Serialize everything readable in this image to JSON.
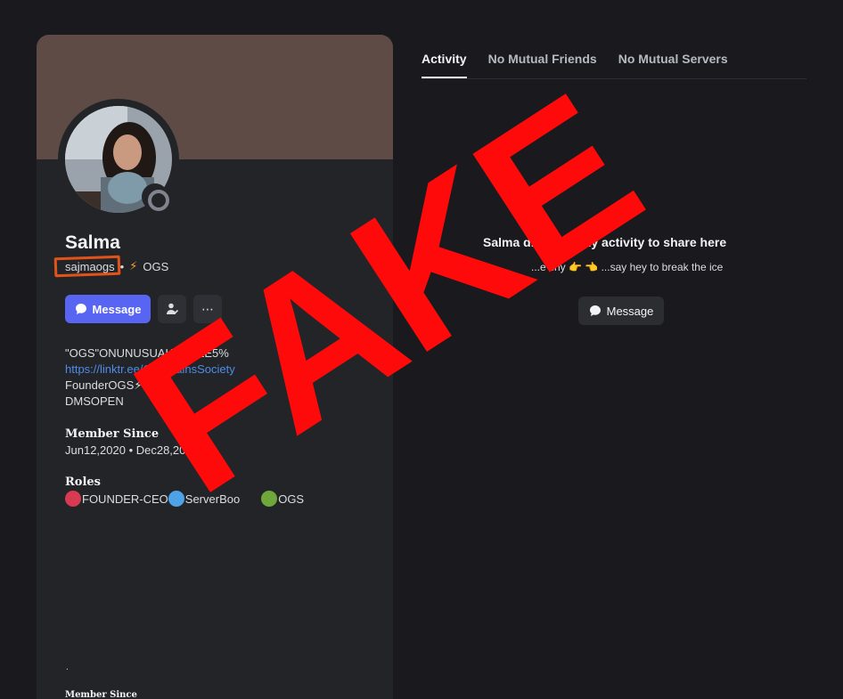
{
  "profile": {
    "display_name": "Salma",
    "username": "sajmaogs",
    "separator": "•",
    "tag": "OGS",
    "message_button": "Message",
    "more_label": "⋯",
    "bio": {
      "line1": "\"OGS\"ONUNUSUALWHALE5%",
      "link": "https://linktr.ee/OnlyGainsSociety",
      "line3": "FounderOGS⚡⚡",
      "line4": "DMSOPEN"
    },
    "member_since": {
      "title": "Member Since",
      "value": "Jun12,2020 • Dec28,2022"
    },
    "roles": {
      "title": "Roles",
      "items": [
        {
          "label": "FOUNDER-CEO",
          "color": "#d83a52"
        },
        {
          "label": "ServerBoo",
          "color": "#4ea3e8"
        },
        {
          "label": "OGS",
          "color": "#6ea83a"
        }
      ]
    },
    "footer_dot": ".",
    "footer_title": "Member Since"
  },
  "tabs": {
    "activity": "Activity",
    "mutual_friends": "No Mutual Friends",
    "mutual_servers": "No Mutual Servers"
  },
  "empty_state": {
    "title": "Salma d... have any activity to share here",
    "subtitle": "...e shy 👉 👈 ...say hey to break the ice",
    "button": "Message"
  },
  "overlay": {
    "stamp_text": "FAKE"
  },
  "colors": {
    "accent": "#5865f2",
    "banner": "#5e4b45",
    "stamp": "#ff0a0a",
    "highlight": "#e2531a"
  }
}
